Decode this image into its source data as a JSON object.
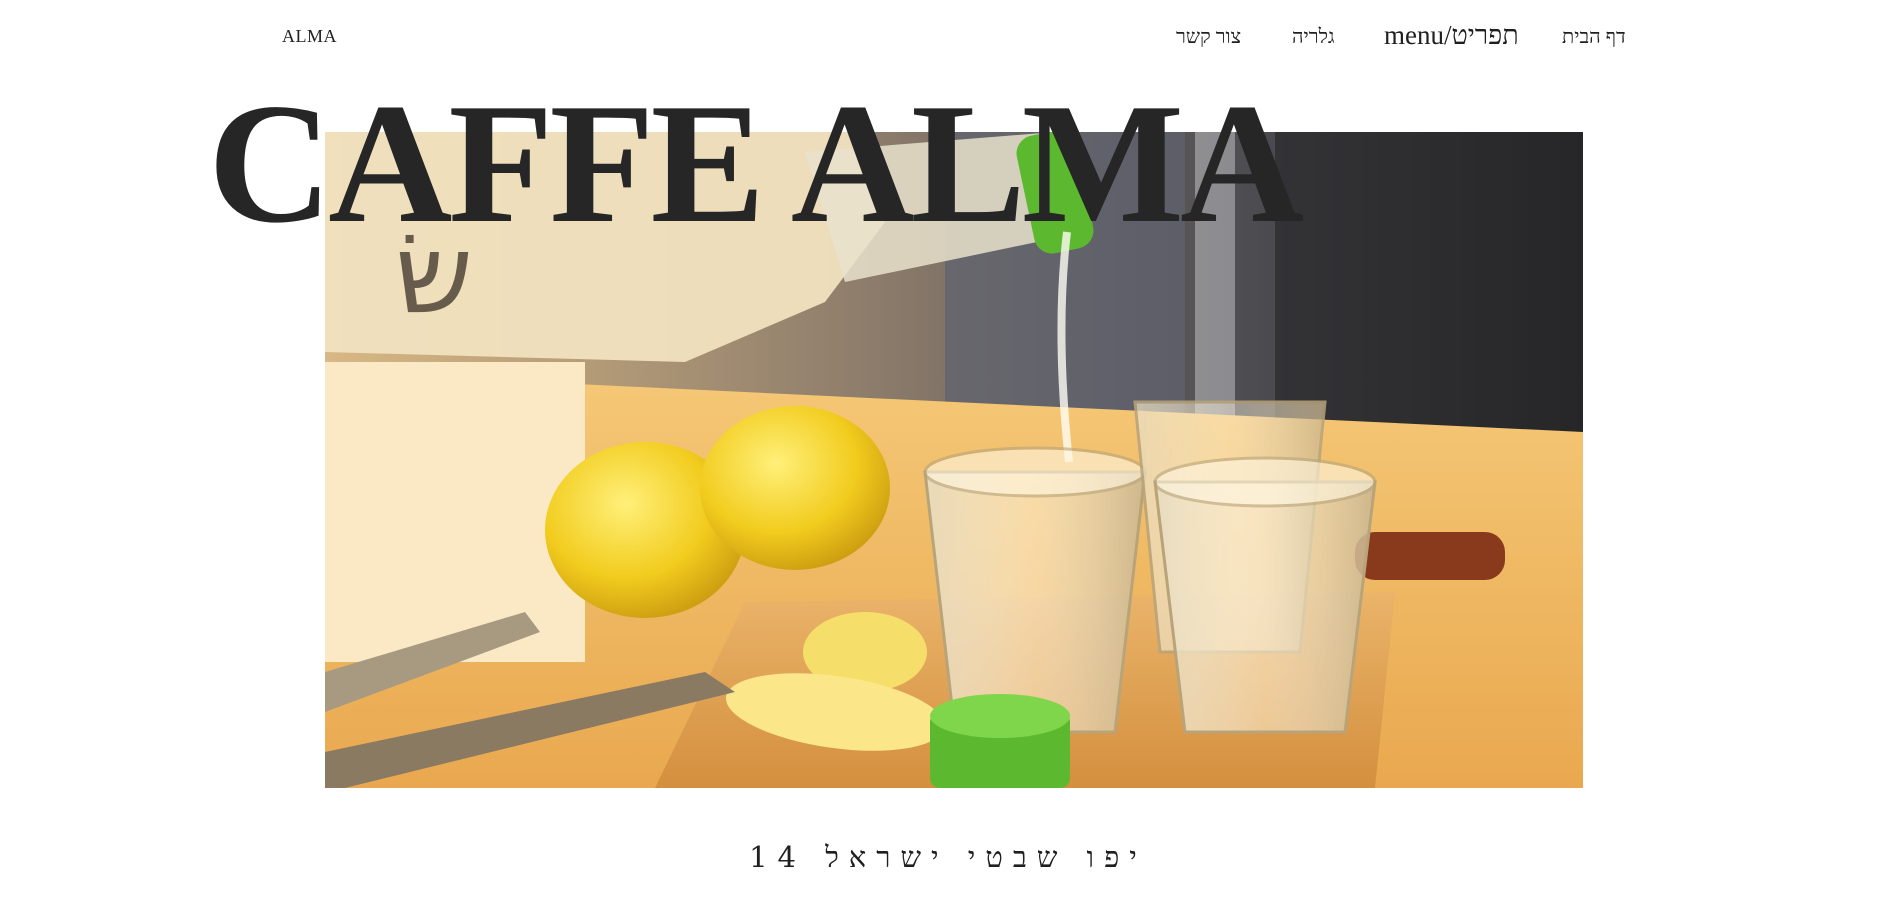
{
  "site": {
    "logo": "ALMA"
  },
  "nav": {
    "items": [
      {
        "label": "דף הבית"
      },
      {
        "label": "menu/תפריט"
      },
      {
        "label": "גלריה"
      },
      {
        "label": "צור קשר"
      }
    ]
  },
  "hero": {
    "title": "CAFFE ALMA",
    "image_icon": "lemon-drink-photo"
  },
  "footer": {
    "address": "יפו שבטי ישראל 14"
  },
  "colors": {
    "text": "#1f1f1f",
    "background": "#ffffff",
    "wood": "#e3a24a",
    "lemon": "#f2cc1e",
    "cap_green": "#5cb82e"
  }
}
